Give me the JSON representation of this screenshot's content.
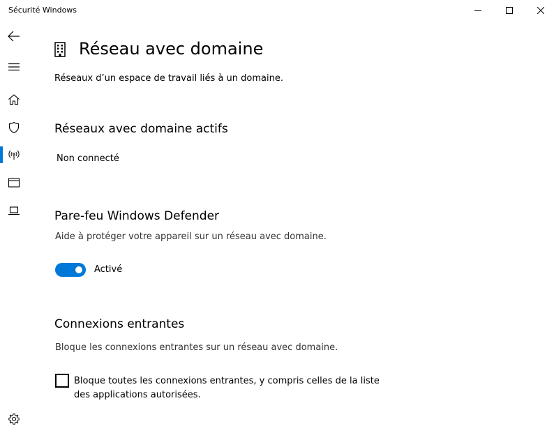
{
  "window": {
    "title": "Sécurité Windows",
    "minimize_icon": "minimize-icon",
    "maximize_icon": "maximize-icon",
    "close_icon": "close-icon"
  },
  "nav": {
    "items": [
      {
        "id": "back",
        "icon": "back-arrow-icon"
      },
      {
        "id": "menu",
        "icon": "hamburger-menu-icon"
      },
      {
        "id": "home",
        "icon": "home-icon"
      },
      {
        "id": "virus-protection",
        "icon": "shield-icon"
      },
      {
        "id": "firewall-network",
        "icon": "wireless-antenna-icon",
        "selected": true
      },
      {
        "id": "app-browser-control",
        "icon": "browser-window-icon"
      },
      {
        "id": "device-security",
        "icon": "laptop-icon"
      },
      {
        "id": "settings",
        "icon": "gear-icon"
      }
    ],
    "accent_color": "#0078d7"
  },
  "page": {
    "icon": "building-icon",
    "title": "Réseau avec domaine",
    "description": "Réseaux d’un espace de travail liés à un domaine."
  },
  "active_networks": {
    "title": "Réseaux avec domaine actifs",
    "value": "Non connecté"
  },
  "firewall": {
    "title": "Pare-feu Windows Defender",
    "description": "Aide à protéger votre appareil sur un réseau avec domaine.",
    "toggle_on": true,
    "toggle_label": "Activé",
    "toggle_color": "#0078d7"
  },
  "incoming": {
    "title": "Connexions entrantes",
    "description": "Bloque les connexions entrantes sur un réseau avec domaine.",
    "checkbox_checked": false,
    "checkbox_label_line1": "Bloque toutes les connexions entrantes, y compris celles de la liste",
    "checkbox_label_line2": "des applications autorisées."
  }
}
